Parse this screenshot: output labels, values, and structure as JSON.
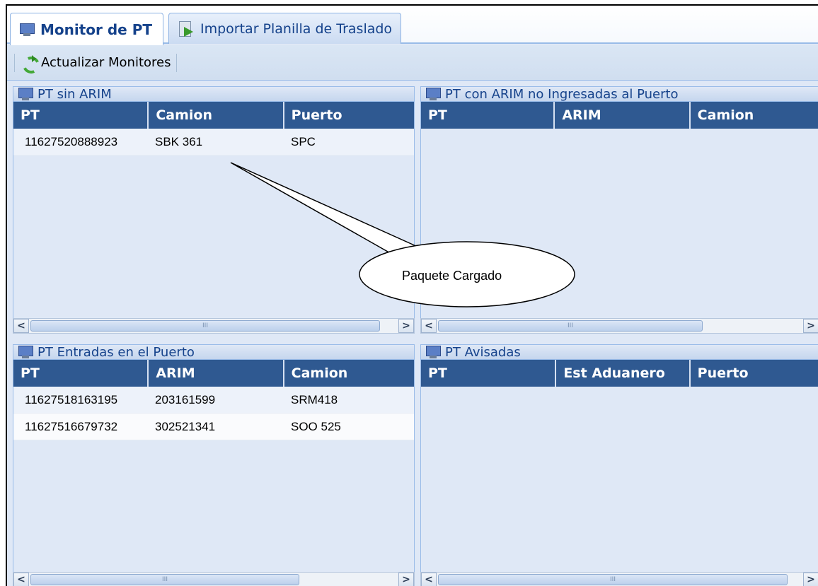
{
  "tabs": {
    "monitor": "Monitor de PT",
    "importar": "Importar Planilla de Traslado"
  },
  "toolbar": {
    "refresh_label": "Actualizar Monitores"
  },
  "panels": {
    "sin_arim": {
      "title": "PT sin ARIM",
      "columns": [
        "PT",
        "Camion",
        "Puerto"
      ],
      "rows": [
        [
          "11627520888923",
          "SBK 361",
          "SPC"
        ]
      ]
    },
    "con_arim": {
      "title": "PT con ARIM no Ingresadas al Puerto",
      "columns": [
        "PT",
        "ARIM",
        "Camion"
      ],
      "rows": []
    },
    "entradas": {
      "title": "PT Entradas en el Puerto",
      "columns": [
        "PT",
        "ARIM",
        "Camion"
      ],
      "rows": [
        [
          "11627518163195",
          "203161599",
          "SRM418"
        ],
        [
          "11627516679732",
          "302521341",
          "SOO 525"
        ]
      ]
    },
    "avisadas": {
      "title": "PT Avisadas",
      "columns": [
        "PT",
        "Est Aduanero",
        "Puerto"
      ],
      "rows": []
    }
  },
  "callout": {
    "text": "Paquete Cargado"
  },
  "scrollbar": {
    "left_arrow": "<",
    "right_arrow": ">",
    "grip": "III"
  }
}
